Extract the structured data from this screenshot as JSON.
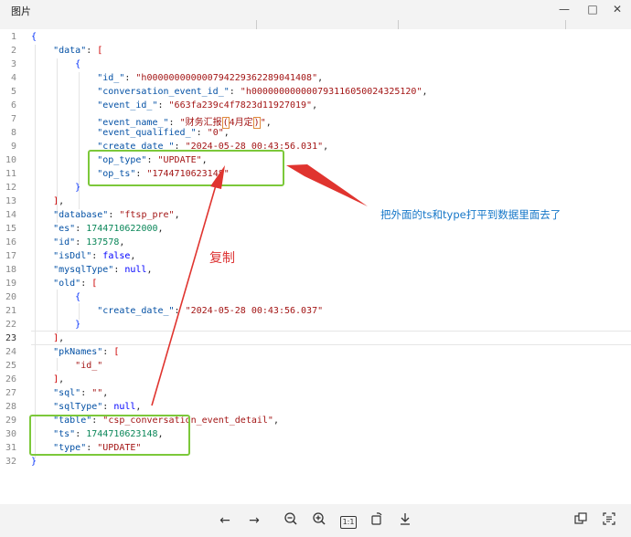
{
  "window": {
    "title": "图片"
  },
  "annotations": {
    "note_blue": "把外面的ts和type打平到数据里面去了",
    "note_red": "复制"
  },
  "toolbar": {
    "items": [
      "prev-arrow-icon",
      "next-arrow-icon",
      "zoom-out-icon",
      "zoom-in-icon",
      "one-to-one-icon",
      "rotate-icon",
      "download-icon",
      "copy-image-icon",
      "ocr-icon"
    ],
    "one_to_one_label": "1:1"
  },
  "code": {
    "line_numbers": [
      "1",
      "2",
      "3",
      "4",
      "5",
      "6",
      "7",
      "8",
      "9",
      "10",
      "11",
      "12",
      "13",
      "14",
      "15",
      "16",
      "17",
      "18",
      "19",
      "20",
      "21",
      "22",
      "23",
      "24",
      "25",
      "26",
      "27",
      "28",
      "29",
      "30",
      "31",
      "32"
    ],
    "lines": [
      [
        [
          "br1",
          "{"
        ]
      ],
      [
        [
          "p",
          "    "
        ],
        [
          "k",
          "\"data\""
        ],
        [
          "p",
          ": "
        ],
        [
          "br2",
          "["
        ]
      ],
      [
        [
          "p",
          "        "
        ],
        [
          "br1",
          "{"
        ]
      ],
      [
        [
          "p",
          "            "
        ],
        [
          "k",
          "\"id_\""
        ],
        [
          "p",
          ": "
        ],
        [
          "s",
          "\"h000000000000794229362289041408\""
        ],
        [
          "p",
          ","
        ]
      ],
      [
        [
          "p",
          "            "
        ],
        [
          "k",
          "\"conversation_event_id_\""
        ],
        [
          "p",
          ": "
        ],
        [
          "s",
          "\"h000000000000793116050024325120\""
        ],
        [
          "p",
          ","
        ]
      ],
      [
        [
          "p",
          "            "
        ],
        [
          "k",
          "\"event_id_\""
        ],
        [
          "p",
          ": "
        ],
        [
          "s",
          "\"663fa239c4f7823d11927019\""
        ],
        [
          "p",
          ","
        ]
      ],
      [
        [
          "p",
          "            "
        ],
        [
          "k",
          "\"event_name_\""
        ],
        [
          "p",
          ": "
        ],
        [
          "s",
          "\"财务汇报"
        ],
        [
          "sbox",
          "("
        ],
        [
          "s",
          "4月定"
        ],
        [
          "sbox",
          ")"
        ],
        [
          "s",
          "\""
        ],
        [
          "p",
          ","
        ]
      ],
      [
        [
          "p",
          "            "
        ],
        [
          "k",
          "\"event_qualified_\""
        ],
        [
          "p",
          ": "
        ],
        [
          "s",
          "\"0\""
        ],
        [
          "p",
          ","
        ]
      ],
      [
        [
          "p",
          "            "
        ],
        [
          "k",
          "\"create_date_\""
        ],
        [
          "p",
          ": "
        ],
        [
          "s",
          "\"2024-05-28 00:43:56.031\""
        ],
        [
          "p",
          ","
        ]
      ],
      [
        [
          "p",
          "            "
        ],
        [
          "k",
          "\"op_type\""
        ],
        [
          "p",
          ": "
        ],
        [
          "s",
          "\"UPDATE\""
        ],
        [
          "p",
          ","
        ]
      ],
      [
        [
          "p",
          "            "
        ],
        [
          "k",
          "\"op_ts\""
        ],
        [
          "p",
          ": "
        ],
        [
          "s",
          "\"1744710623148\""
        ]
      ],
      [
        [
          "p",
          "        "
        ],
        [
          "br1",
          "}"
        ]
      ],
      [
        [
          "p",
          "    "
        ],
        [
          "br2",
          "]"
        ],
        [
          "p",
          ","
        ]
      ],
      [
        [
          "p",
          "    "
        ],
        [
          "k",
          "\"database\""
        ],
        [
          "p",
          ": "
        ],
        [
          "s",
          "\"ftsp_pre\""
        ],
        [
          "p",
          ","
        ]
      ],
      [
        [
          "p",
          "    "
        ],
        [
          "k",
          "\"es\""
        ],
        [
          "p",
          ": "
        ],
        [
          "n",
          "1744710622000"
        ],
        [
          "p",
          ","
        ]
      ],
      [
        [
          "p",
          "    "
        ],
        [
          "k",
          "\"id\""
        ],
        [
          "p",
          ": "
        ],
        [
          "n",
          "137578"
        ],
        [
          "p",
          ","
        ]
      ],
      [
        [
          "p",
          "    "
        ],
        [
          "k",
          "\"isDdl\""
        ],
        [
          "p",
          ": "
        ],
        [
          "b",
          "false"
        ],
        [
          "p",
          ","
        ]
      ],
      [
        [
          "p",
          "    "
        ],
        [
          "k",
          "\"mysqlType\""
        ],
        [
          "p",
          ": "
        ],
        [
          "b",
          "null"
        ],
        [
          "p",
          ","
        ]
      ],
      [
        [
          "p",
          "    "
        ],
        [
          "k",
          "\"old\""
        ],
        [
          "p",
          ": "
        ],
        [
          "br2",
          "["
        ]
      ],
      [
        [
          "p",
          "        "
        ],
        [
          "br1",
          "{"
        ]
      ],
      [
        [
          "p",
          "            "
        ],
        [
          "k",
          "\"create_date_\""
        ],
        [
          "p",
          ": "
        ],
        [
          "s",
          "\"2024-05-28 00:43:56.037\""
        ]
      ],
      [
        [
          "p",
          "        "
        ],
        [
          "br1",
          "}"
        ]
      ],
      [
        [
          "p",
          "    "
        ],
        [
          "br2",
          "]"
        ],
        [
          "p",
          ","
        ]
      ],
      [
        [
          "p",
          "    "
        ],
        [
          "k",
          "\"pkNames\""
        ],
        [
          "p",
          ": "
        ],
        [
          "br2",
          "["
        ]
      ],
      [
        [
          "p",
          "        "
        ],
        [
          "s",
          "\"id_\""
        ]
      ],
      [
        [
          "p",
          "    "
        ],
        [
          "br2",
          "]"
        ],
        [
          "p",
          ","
        ]
      ],
      [
        [
          "p",
          "    "
        ],
        [
          "k",
          "\"sql\""
        ],
        [
          "p",
          ": "
        ],
        [
          "s",
          "\"\""
        ],
        [
          "p",
          ","
        ]
      ],
      [
        [
          "p",
          "    "
        ],
        [
          "k",
          "\"sqlType\""
        ],
        [
          "p",
          ": "
        ],
        [
          "b",
          "null"
        ],
        [
          "p",
          ","
        ]
      ],
      [
        [
          "p",
          "    "
        ],
        [
          "k",
          "\"table\""
        ],
        [
          "p",
          ": "
        ],
        [
          "s",
          "\"csp_conversation_event_detail\""
        ],
        [
          "p",
          ","
        ]
      ],
      [
        [
          "p",
          "    "
        ],
        [
          "k",
          "\"ts\""
        ],
        [
          "p",
          ": "
        ],
        [
          "n",
          "1744710623148"
        ],
        [
          "p",
          ","
        ]
      ],
      [
        [
          "p",
          "    "
        ],
        [
          "k",
          "\"type\""
        ],
        [
          "p",
          ": "
        ],
        [
          "s",
          "\"UPDATE\""
        ]
      ],
      [
        [
          "br1",
          "}"
        ]
      ]
    ]
  }
}
